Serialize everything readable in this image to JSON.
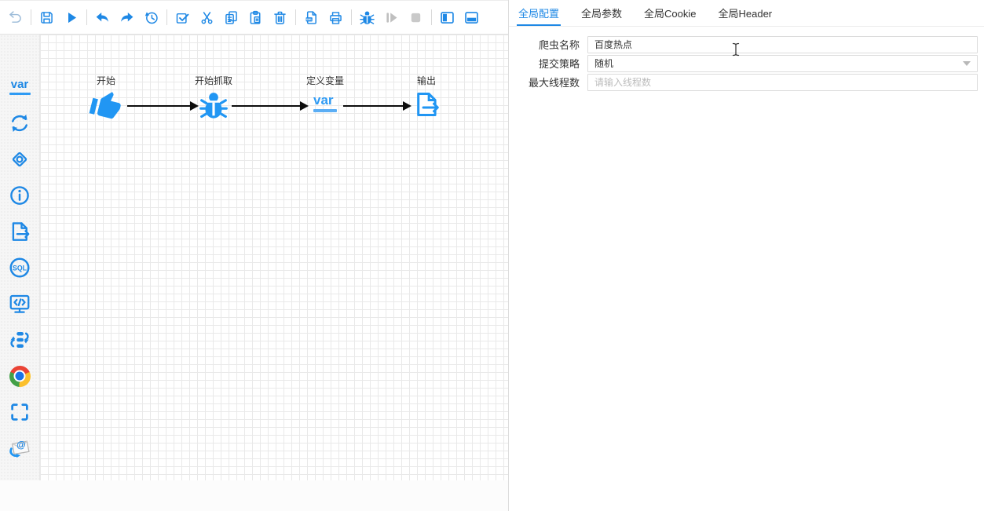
{
  "colors": {
    "accent": "#1E88E5",
    "node_blue": "#2196F3",
    "edge": "#0d0d0d",
    "grid": "#e9e9e9",
    "disabled": "#bfbfbf"
  },
  "toolbar": {
    "items": [
      {
        "icon": "return-icon",
        "state": "muted"
      },
      {
        "icon": "save-icon"
      },
      {
        "icon": "run-icon"
      },
      {
        "icon": "undo-icon"
      },
      {
        "icon": "redo-icon"
      },
      {
        "icon": "history-icon"
      },
      {
        "icon": "multi-select-icon"
      },
      {
        "icon": "cut-icon"
      },
      {
        "icon": "copy-icon"
      },
      {
        "icon": "paste-icon"
      },
      {
        "icon": "delete-icon"
      },
      {
        "icon": "export-xml-icon"
      },
      {
        "icon": "print-icon"
      },
      {
        "icon": "debug-icon"
      },
      {
        "icon": "step-over-icon",
        "state": "disabled"
      },
      {
        "icon": "stop-icon",
        "state": "disabled"
      },
      {
        "icon": "toggle-left-panel-icon"
      },
      {
        "icon": "toggle-bottom-panel-icon"
      }
    ]
  },
  "sidebar": {
    "items": [
      {
        "name": "crawler-node-tool",
        "icon": "bug-icon"
      },
      {
        "name": "variable-node-tool",
        "icon": "var-icon",
        "label": "var"
      },
      {
        "name": "loop-node-tool",
        "icon": "loop-arrows-icon"
      },
      {
        "name": "condition-node-tool",
        "icon": "diamond-icon"
      },
      {
        "name": "comment-node-tool",
        "icon": "info-circle-icon"
      },
      {
        "name": "output-node-tool",
        "icon": "document-arrow-icon"
      },
      {
        "name": "sql-node-tool",
        "icon": "sql-circle-icon",
        "label": "SQL"
      },
      {
        "name": "script-node-tool",
        "icon": "code-monitor-icon"
      },
      {
        "name": "subprocess-node-tool",
        "icon": "subflow-arrows-icon"
      },
      {
        "name": "browser-node-tool",
        "icon": "chrome-icon"
      },
      {
        "name": "capture-node-tool",
        "icon": "corner-brackets-icon"
      },
      {
        "name": "email-node-tool",
        "icon": "email-at-icon"
      }
    ]
  },
  "canvas": {
    "nodes": [
      {
        "label": "开始",
        "icon": "thumb-up-icon"
      },
      {
        "label": "开始抓取",
        "icon": "bug-icon"
      },
      {
        "label": "定义变量",
        "icon": "var-icon",
        "glyph": "var"
      },
      {
        "label": "输出",
        "icon": "document-arrow-icon"
      }
    ],
    "edges": [
      {
        "from": "开始",
        "to": "开始抓取"
      },
      {
        "from": "开始抓取",
        "to": "定义变量"
      },
      {
        "from": "定义变量",
        "to": "输出"
      }
    ]
  },
  "panel": {
    "tabs": [
      {
        "label": "全局配置",
        "active": true
      },
      {
        "label": "全局参数",
        "active": false
      },
      {
        "label": "全局Cookie",
        "active": false
      },
      {
        "label": "全局Header",
        "active": false
      }
    ],
    "form": {
      "name": {
        "label": "爬虫名称",
        "value": "百度热点"
      },
      "strategy": {
        "label": "提交策略",
        "value": "随机"
      },
      "threads": {
        "label": "最大线程数",
        "placeholder": "请输入线程数"
      }
    }
  }
}
